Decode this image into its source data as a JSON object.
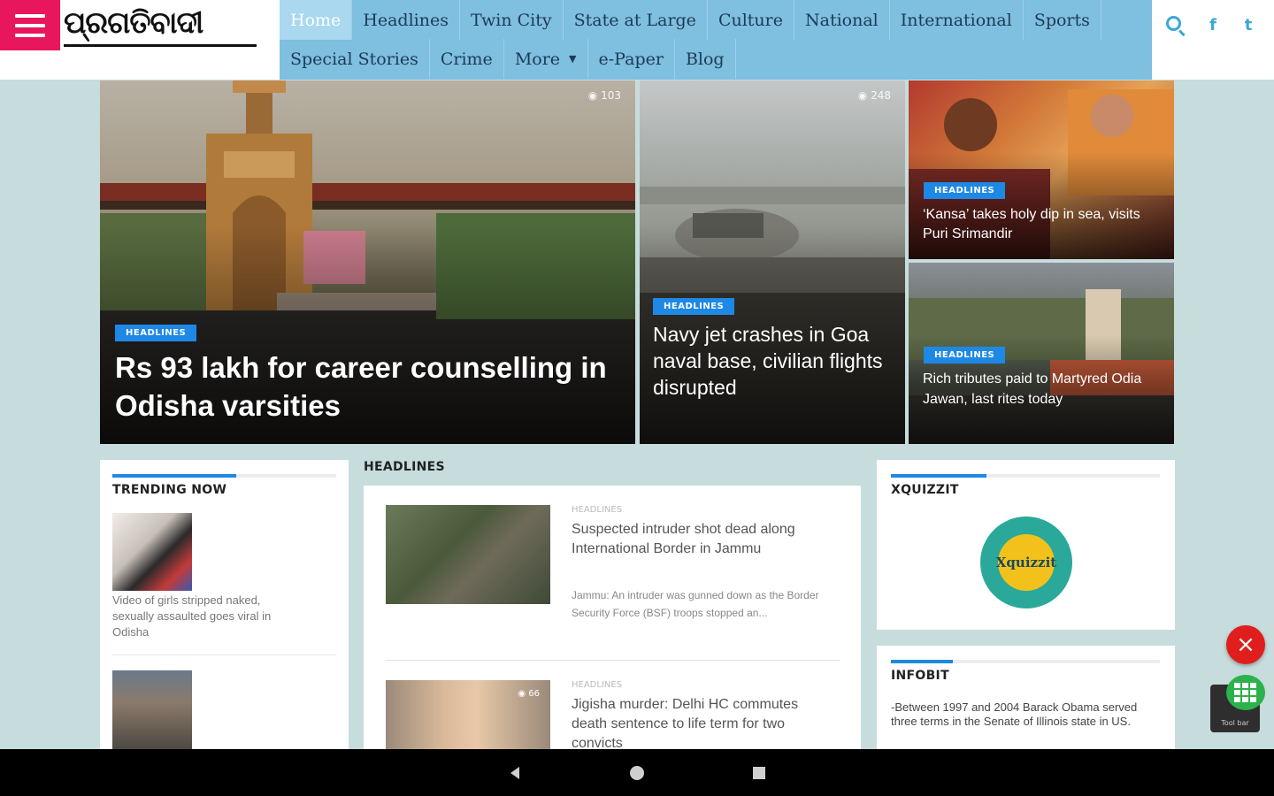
{
  "header": {
    "logo_text": "ପ୍ରଗତିବାଦୀ",
    "nav_row1": [
      "Home",
      "Headlines",
      "Twin City",
      "State at Large",
      "Culture",
      "National",
      "International",
      "Sports"
    ],
    "nav_row2": [
      "Special Stories",
      "Crime",
      "More",
      "e-Paper",
      "Blog"
    ],
    "social": {
      "facebook": "f",
      "twitter": "t"
    }
  },
  "hero": {
    "main": {
      "badge": "HEADLINES",
      "title": "Rs 93 lakh for career counselling in Odisha varsities",
      "views": "103"
    },
    "middle": {
      "badge": "HEADLINES",
      "title": "Navy jet crashes in Goa naval base, civilian flights disrupted",
      "views": "248"
    },
    "top_right": {
      "badge": "HEADLINES",
      "title": "‘Kansa’ takes holy dip in sea, visits Puri Srimandir"
    },
    "bottom_right": {
      "badge": "HEADLINES",
      "title": "Rich tributes paid to Martyred Odia Jawan, last rites today"
    }
  },
  "trending": {
    "title": "TRENDING NOW",
    "items": [
      {
        "caption": "Video of girls stripped naked, sexually assaulted goes viral in Odisha"
      }
    ]
  },
  "headlines": {
    "section_title": "HEADLINES",
    "items": [
      {
        "category": "HEADLINES",
        "title": "Suspected intruder shot dead along International Border in Jammu",
        "excerpt": "Jammu: An intruder was gunned down as the Border Security Force (BSF) troops stopped an..."
      },
      {
        "category": "HEADLINES",
        "title": "Jigisha murder: Delhi HC commutes death sentence to life term for two convicts",
        "views": "66"
      }
    ]
  },
  "xquizzit": {
    "title": "XQUIZZIT",
    "logo_text": "Xquizzit"
  },
  "infobit": {
    "title": "INFOBIT",
    "text": "-Between 1997 and 2004 Barack Obama served three terms in the Senate of Illinois state in US."
  },
  "fabs": {
    "close": "×",
    "tool_label": "Tool bar"
  }
}
